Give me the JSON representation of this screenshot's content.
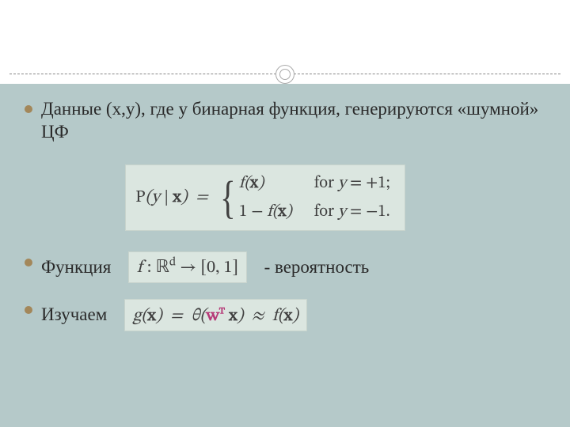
{
  "bullets": {
    "b1": "Данные (x,y), где y бинарная функция, генерируются «шумной» ЦФ",
    "b2_before": "Функция  ",
    "b2_after": "  - вероятность",
    "b3": "Изучаем  "
  },
  "formula_main": {
    "lhs": "P(y | x)  =",
    "case1_left": "f(x)",
    "case1_right": "for y = +1;",
    "case2_left": "1 − f(x)",
    "case2_right": "for y = −1."
  },
  "formula_f": {
    "text": "f : ℝᵈ → [0, 1]"
  },
  "formula_g": {
    "lhs": "g(x)  =  θ(",
    "wt": "wᵀ",
    "mid": " x)   ≈   f(x)"
  }
}
